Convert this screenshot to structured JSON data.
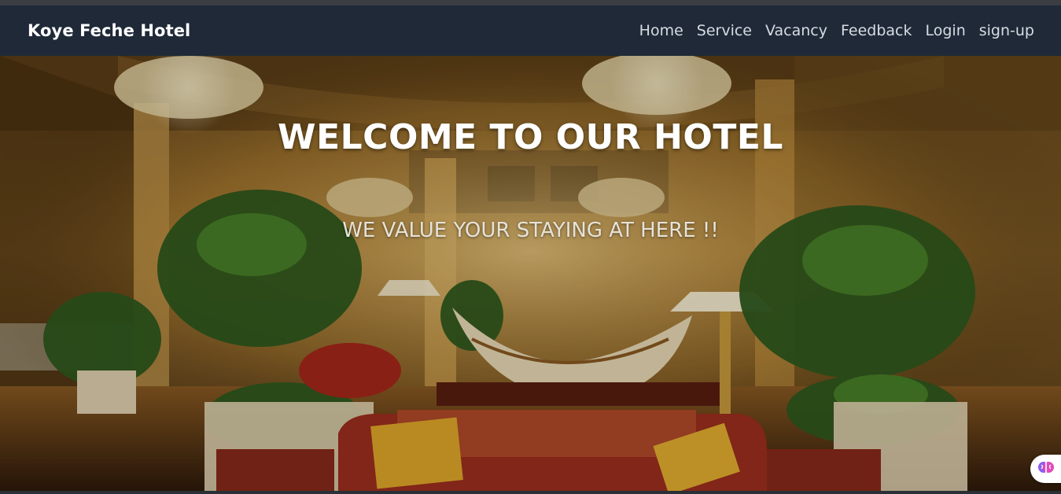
{
  "navbar": {
    "brand": "Koye Feche Hotel",
    "links": [
      "Home",
      "Service",
      "Vacancy",
      "Feedback",
      "Login",
      "sign-up"
    ]
  },
  "hero": {
    "title": "WELCOME TO OUR HOTEL",
    "subtitle": "WE VALUE YOUR STAYING AT HERE !!",
    "background": "hotel-lobby-photo"
  },
  "floating_widget": {
    "icon": "brain-icon"
  },
  "colors": {
    "navbar_bg": "#1f2938",
    "brand_text": "#ffffff",
    "nav_text": "#d7dce3",
    "hero_title": "#ffffff",
    "hero_subtitle": "#e6e2d8"
  }
}
